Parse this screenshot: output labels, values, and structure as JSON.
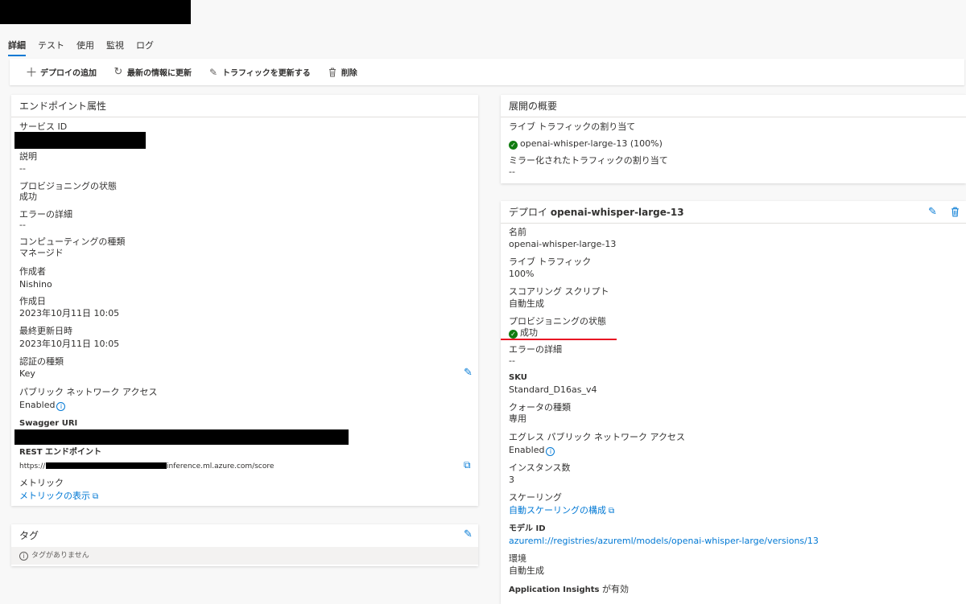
{
  "tabs": [
    {
      "label": "詳細",
      "active": true
    },
    {
      "label": "テスト"
    },
    {
      "label": "使用"
    },
    {
      "label": "監視"
    },
    {
      "label": "ログ"
    }
  ],
  "toolbar": {
    "add_deploy": "デプロイの追加",
    "refresh": "最新の情報に更新",
    "update_traffic": "トラフィックを更新する",
    "delete": "削除"
  },
  "endpoint": {
    "title": "エンドポイント属性",
    "service_id_label": "サービス ID",
    "description_label": "説明",
    "description_value": "--",
    "provisioning_label": "プロビジョニングの状態",
    "provisioning_value": "成功",
    "error_label": "エラーの詳細",
    "error_value": "--",
    "compute_label": "コンピューティングの種類",
    "compute_value": "マネージド",
    "creator_label": "作成者",
    "creator_value": "Nishino",
    "created_label": "作成日",
    "created_value": "2023年10月11日 10:05",
    "updated_label": "最終更新日時",
    "updated_value": "2023年10月11日 10:05",
    "auth_label": "認証の種類",
    "auth_value": "Key",
    "public_access_label": "パブリック ネットワーク アクセス",
    "public_access_value": "Enabled",
    "swagger_label": "Swagger URI",
    "rest_label": "REST エンドポイント",
    "rest_prefix": "https://",
    "rest_suffix": "inference.ml.azure.com/score",
    "metrics_label": "メトリック",
    "metrics_link": "メトリックの表示"
  },
  "tags": {
    "title": "タグ",
    "empty": "タグがありません"
  },
  "overview": {
    "title": "展開の概要",
    "live_label": "ライブ トラフィックの割り当て",
    "live_value": "openai-whisper-large-13 (100%)",
    "mirror_label": "ミラー化されたトラフィックの割り当て",
    "mirror_value": "--"
  },
  "deploy": {
    "title_prefix": "デプロイ ",
    "title_name": "openai-whisper-large-13",
    "name_label": "名前",
    "name_value": "openai-whisper-large-13",
    "traffic_label": "ライブ トラフィック",
    "traffic_value": "100%",
    "script_label": "スコアリング スクリプト",
    "script_value": "自動生成",
    "prov_label": "プロビジョニングの状態",
    "prov_value": "成功",
    "error_label": "エラーの詳細",
    "error_value": "--",
    "sku_label": "SKU",
    "sku_value": "Standard_D16as_v4",
    "quota_label": "クォータの種類",
    "quota_value": "専用",
    "egress_label": "エグレス パブリック ネットワーク アクセス",
    "egress_value": "Enabled",
    "instances_label": "インスタンス数",
    "instances_value": "3",
    "scaling_label": "スケーリング",
    "scaling_link": "自動スケーリングの構成",
    "model_label": "モデル ID",
    "model_link": "azureml://registries/azureml/models/openai-whisper-large/versions/13",
    "env_label": "環境",
    "env_value": "自動生成",
    "appinsights_label": "Application Insights が有効",
    "appinsights_prefix": "Application Insights",
    "appinsights_suffix": " が有効"
  }
}
